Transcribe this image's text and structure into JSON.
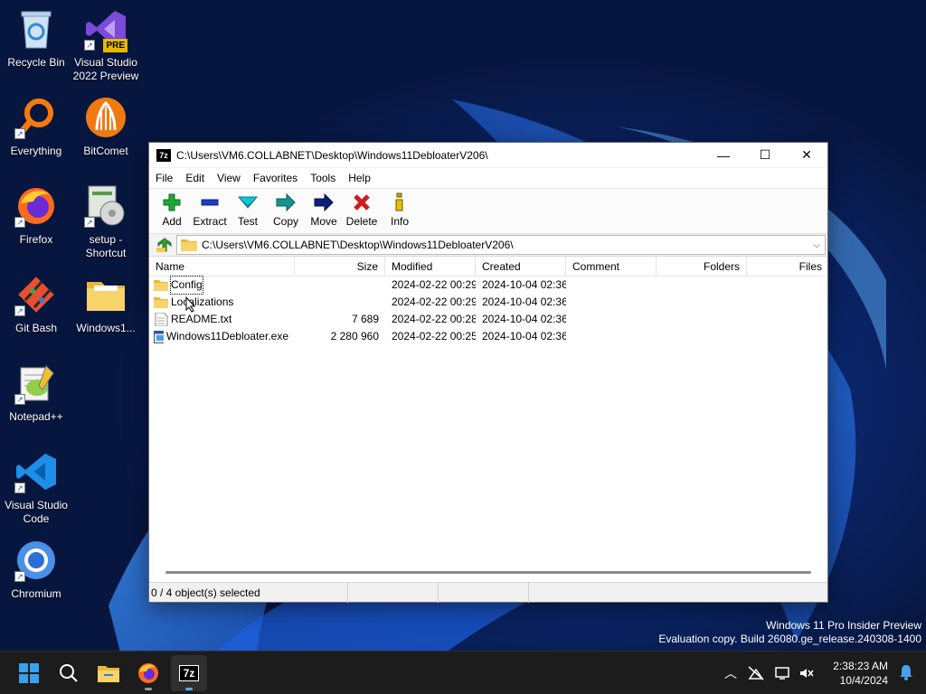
{
  "desktop": {
    "icons": [
      {
        "label": "Recycle Bin",
        "icon": "recycle-bin-icon"
      },
      {
        "label": "Visual Studio 2022 Preview",
        "badge": "PRE",
        "icon": "visual-studio-icon"
      },
      {
        "label": "Everything",
        "icon": "everything-search-icon"
      },
      {
        "label": "BitComet",
        "icon": "bitcomet-icon"
      },
      {
        "label": "Firefox",
        "icon": "firefox-icon"
      },
      {
        "label": "setup - Shortcut",
        "icon": "setup-icon"
      },
      {
        "label": "Git Bash",
        "icon": "git-bash-icon"
      },
      {
        "label": "Windows1...",
        "icon": "folder-icon"
      },
      {
        "label": "Notepad++",
        "icon": "notepad-plus-plus-icon"
      },
      {
        "label": "Visual Studio Code",
        "icon": "vscode-icon"
      },
      {
        "label": "Chromium",
        "icon": "chromium-icon"
      }
    ]
  },
  "window": {
    "title": "C:\\Users\\VM6.COLLABNET\\Desktop\\Windows11DebloaterV206\\",
    "app_icon_text": "7z",
    "controls": {
      "minimize": "—",
      "maximize": "☐",
      "close": "✕"
    },
    "menu": [
      "File",
      "Edit",
      "View",
      "Favorites",
      "Tools",
      "Help"
    ],
    "toolbar": [
      {
        "label": "Add",
        "icon": "add-icon",
        "color": "#1ea83a"
      },
      {
        "label": "Extract",
        "icon": "extract-icon",
        "color": "#1b3fc4"
      },
      {
        "label": "Test",
        "icon": "test-icon",
        "color": "#12a5b8"
      },
      {
        "label": "Copy",
        "icon": "copy-icon",
        "color": "#14978f"
      },
      {
        "label": "Move",
        "icon": "move-icon",
        "color": "#0d1f7a"
      },
      {
        "label": "Delete",
        "icon": "delete-icon",
        "color": "#d01b1b"
      },
      {
        "label": "Info",
        "icon": "info-icon",
        "color": "#c9a400"
      }
    ],
    "address": "C:\\Users\\VM6.COLLABNET\\Desktop\\Windows11DebloaterV206\\",
    "columns": {
      "name": "Name",
      "size": "Size",
      "modified": "Modified",
      "created": "Created",
      "comment": "Comment",
      "folders": "Folders",
      "files": "Files"
    },
    "rows": [
      {
        "name": "Config",
        "type": "folder",
        "size": "",
        "modified": "2024-02-22 00:29",
        "created": "2024-10-04 02:36"
      },
      {
        "name": "Localizations",
        "type": "folder",
        "size": "",
        "modified": "2024-02-22 00:29",
        "created": "2024-10-04 02:36"
      },
      {
        "name": "README.txt",
        "type": "text",
        "size": "7 689",
        "modified": "2024-02-22 00:28",
        "created": "2024-10-04 02:36"
      },
      {
        "name": "Windows11Debloater.exe",
        "type": "exe",
        "size": "2 280 960",
        "modified": "2024-02-22 00:25",
        "created": "2024-10-04 02:36"
      }
    ],
    "status": "0 / 4 object(s) selected"
  },
  "watermark": {
    "line1": "Windows 11 Pro Insider Preview",
    "line2": "Evaluation copy. Build 26080.ge_release.240308-1400"
  },
  "taskbar": {
    "items": [
      "start-icon",
      "search-icon",
      "file-explorer-icon",
      "firefox-icon",
      "7zip-icon"
    ],
    "time": "2:38:23 AM",
    "date": "10/4/2024"
  },
  "colors": {
    "accent": "#0067c0",
    "folder": "#f2c94c"
  }
}
